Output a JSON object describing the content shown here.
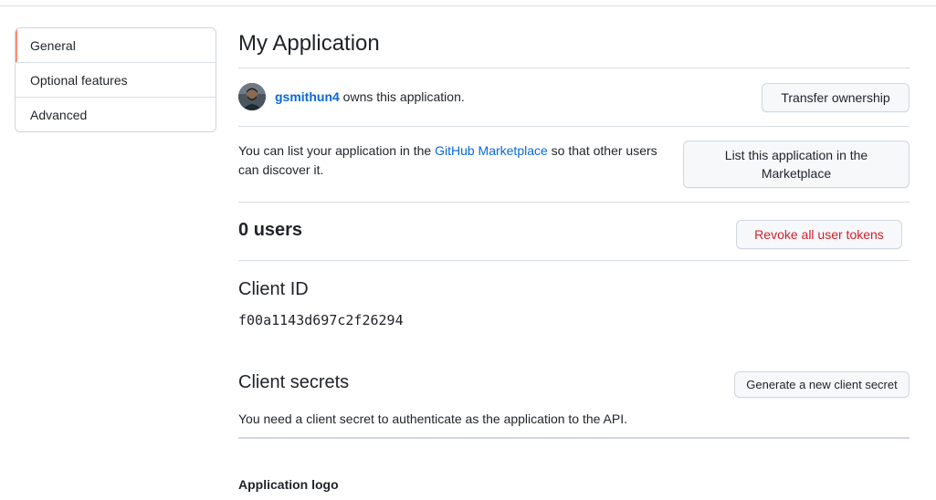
{
  "sidebar": {
    "items": [
      {
        "label": "General",
        "active": true
      },
      {
        "label": "Optional features",
        "active": false
      },
      {
        "label": "Advanced",
        "active": false
      }
    ]
  },
  "app": {
    "title": "My Application"
  },
  "owner": {
    "username": "gsmithun4",
    "suffix": "owns this application.",
    "transfer_button": "Transfer ownership"
  },
  "marketplace": {
    "text_before": "You can list your application in the ",
    "link": "GitHub Marketplace",
    "text_after": " so that other users can discover it.",
    "button": "List this application in the Marketplace"
  },
  "users": {
    "count": "0",
    "label": "users",
    "revoke_button": "Revoke all user tokens"
  },
  "client_id": {
    "heading": "Client ID",
    "value": "f00a1143d697c2f26294"
  },
  "client_secrets": {
    "heading": "Client secrets",
    "generate_button": "Generate a new client secret",
    "note": "You need a client secret to authenticate as the application to the API."
  },
  "application_logo": {
    "heading": "Application logo"
  },
  "colors": {
    "link": "#0969da",
    "danger": "#cf222e",
    "active_indicator": "#fd8c73",
    "border": "#d0d7de"
  }
}
